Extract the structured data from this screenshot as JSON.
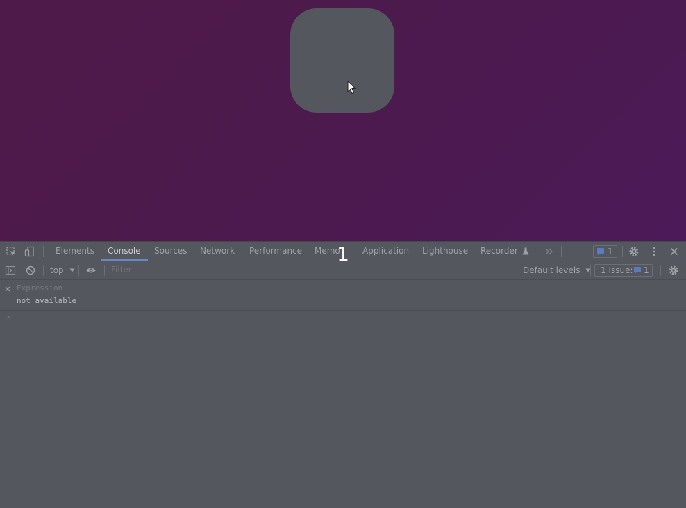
{
  "overlay": {
    "number": "1"
  },
  "devtools": {
    "tabs": [
      {
        "label": "Elements"
      },
      {
        "label": "Console"
      },
      {
        "label": "Sources"
      },
      {
        "label": "Network"
      },
      {
        "label": "Performance"
      },
      {
        "label": "Memo"
      },
      {
        "label": "Application"
      },
      {
        "label": "Lighthouse"
      },
      {
        "label": "Recorder"
      }
    ],
    "issues_count": "1",
    "toolbar": {
      "context": "top",
      "filter_placeholder": "Filter",
      "levels": "Default levels",
      "issues_label": "1 Issue:",
      "issues_count": "1"
    },
    "live_expression": {
      "placeholder": "Expression",
      "value": "not available"
    },
    "prompt_symbol": "›"
  },
  "colors": {
    "page_background": "#4d1a4e",
    "square": "#54575d",
    "devtools_background": "#54575d",
    "accent_blue": "#6c88c4"
  },
  "icons": [
    "inspect-icon",
    "device-toggle-icon",
    "more-tabs-icon",
    "issues-flag-icon",
    "settings-gear-icon",
    "kebab-menu-icon",
    "close-icon",
    "sidebar-toggle-icon",
    "clear-console-icon",
    "eye-icon",
    "dropdown-caret-icon",
    "flask-icon",
    "mouse-cursor-icon"
  ]
}
